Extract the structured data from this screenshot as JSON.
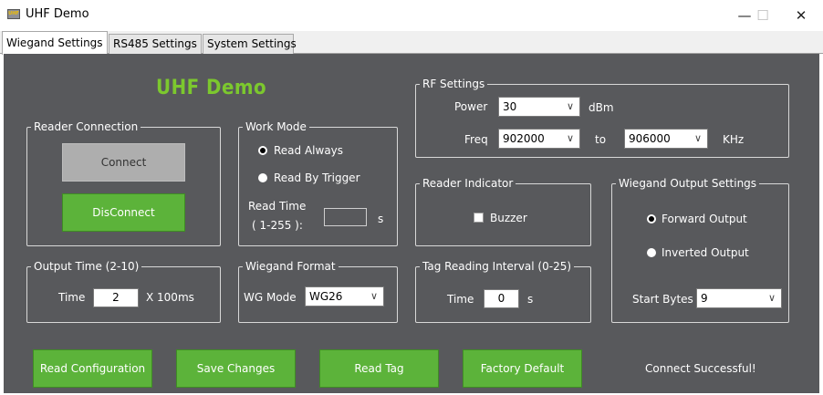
{
  "window": {
    "title": "UHF Demo",
    "icon_text": "UHF",
    "minimize": "—",
    "maximize": "☐",
    "close": "✕"
  },
  "tabs": [
    {
      "label": "Wiegand Settings",
      "active": true
    },
    {
      "label": "RS485 Settings",
      "active": false
    },
    {
      "label": "System Settings",
      "active": false
    }
  ],
  "header": {
    "title": "UHF Demo",
    "accent": "#7cc82e"
  },
  "reader_connection": {
    "title": "Reader Connection",
    "connect": "Connect",
    "disconnect": "DisConnect"
  },
  "work_mode": {
    "title": "Work Mode",
    "read_always": "Read Always",
    "read_by_trigger": "Read By Trigger",
    "selected": "Read Always",
    "read_time_label": "Read Time",
    "read_time_range": "( 1-255 ):",
    "read_time_value": "",
    "read_time_unit": "s"
  },
  "output_time": {
    "title": "Output Time (2-10)",
    "label": "Time",
    "value": "2",
    "unit": "X 100ms"
  },
  "wiegand_format": {
    "title": "Wiegand Format",
    "label": "WG Mode",
    "value": "WG26"
  },
  "rf_settings": {
    "title": "RF Settings",
    "power_label": "Power",
    "power_value": "30",
    "power_unit": "dBm",
    "freq_label": "Freq",
    "freq_from": "902000",
    "freq_to_label": "to",
    "freq_to": "906000",
    "freq_unit": "KHz"
  },
  "reader_indicator": {
    "title": "Reader Indicator",
    "buzzer": "Buzzer",
    "buzzer_checked": false
  },
  "tag_interval": {
    "title": "Tag Reading Interval (0-25)",
    "label": "Time",
    "value": "0",
    "unit": "s"
  },
  "wiegand_output": {
    "title": "Wiegand Output Settings",
    "forward": "Forward Output",
    "inverted": "Inverted Output",
    "selected": "Forward Output",
    "start_bytes_label": "Start Bytes",
    "start_bytes_value": "9"
  },
  "actions": {
    "read_configuration": "Read Configuration",
    "save_changes": "Save Changes",
    "read_tag": "Read Tag",
    "factory_default": "Factory Default"
  },
  "status": "Connect Successful!",
  "colors": {
    "panel": "#58595c",
    "button_green": "#5cb33a",
    "button_gray": "#aeaeae"
  }
}
